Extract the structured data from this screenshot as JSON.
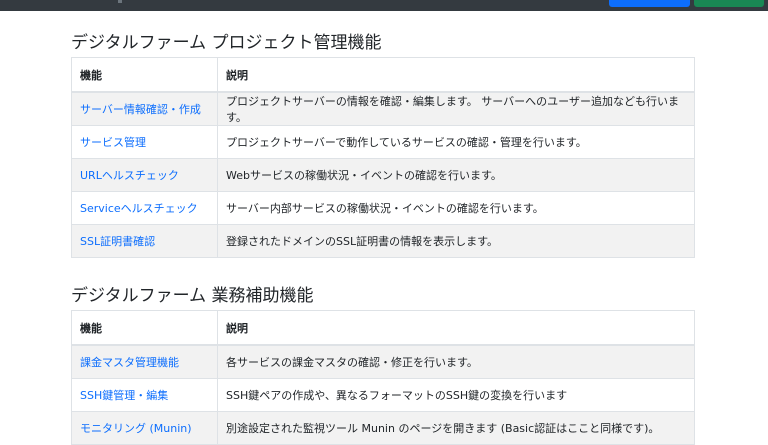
{
  "sections": [
    {
      "title": "デジタルファーム プロジェクト管理機能",
      "headers": [
        "機能",
        "説明"
      ],
      "rows": [
        {
          "name": "サーバー情報確認・作成",
          "desc": "プロジェクトサーバーの情報を確認・編集します。 サーバーへのユーザー追加なども行います。"
        },
        {
          "name": "サービス管理",
          "desc": "プロジェクトサーバーで動作しているサービスの確認・管理を行います。"
        },
        {
          "name": "URLヘルスチェック",
          "desc": "Webサービスの稼働状況・イベントの確認を行います。"
        },
        {
          "name": "Serviceヘルスチェック",
          "desc": "サーバー内部サービスの稼働状況・イベントの確認を行います。"
        },
        {
          "name": "SSL証明書確認",
          "desc": "登録されたドメインのSSL証明書の情報を表示します。"
        }
      ]
    },
    {
      "title": "デジタルファーム 業務補助機能",
      "headers": [
        "機能",
        "説明"
      ],
      "rows": [
        {
          "name": "課金マスタ管理機能",
          "desc": "各サービスの課金マスタの確認・修正を行います。"
        },
        {
          "name": "SSH鍵管理・編集",
          "desc": "SSH鍵ペアの作成や、異なるフォーマットのSSH鍵の変換を行います"
        },
        {
          "name": "モニタリング (Munin)",
          "desc": "別途設定された監視ツール Munin のページを開きます (Basic認証はここと同様です)。"
        }
      ]
    }
  ],
  "colors": {
    "link": "#0d6efd",
    "navbar": "#343a40",
    "btn_primary": "#0d6efd",
    "btn_success": "#198754",
    "stripe": "#f2f2f2"
  }
}
